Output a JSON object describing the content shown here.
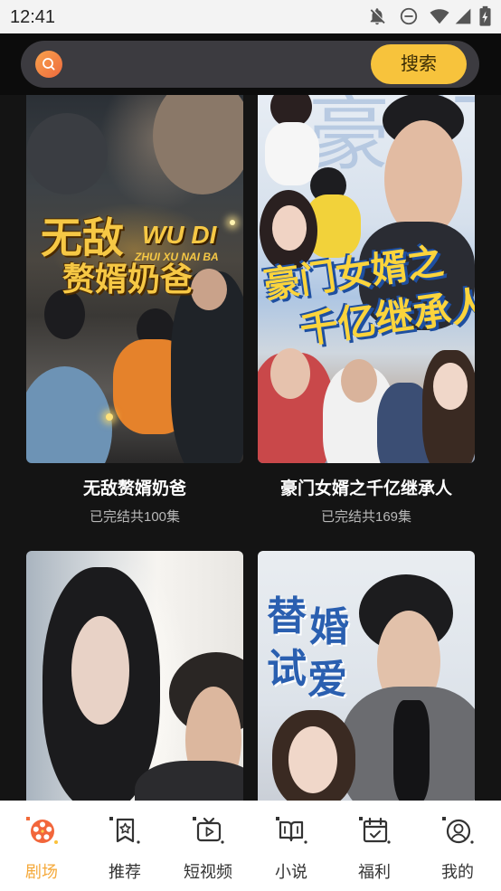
{
  "status_bar": {
    "time": "12:41",
    "icons": [
      "notifications-off-icon",
      "do-not-disturb-icon",
      "wifi-icon",
      "signal-icon",
      "battery-charging-icon"
    ]
  },
  "search": {
    "value": "",
    "icon": "search-icon",
    "button_label": "搜索"
  },
  "dramas": [
    {
      "title": "无敌赘婿奶爸",
      "episodes": "已完结共100集",
      "poster_text": {
        "title_1": "无敌",
        "pinyin_1": "WU DI",
        "pinyin_2": "ZHUI XU NAI BA",
        "title_2": "赘婿奶爸"
      }
    },
    {
      "title": "豪门女婿之千亿继承人",
      "episodes": "已完结共169集",
      "poster_text": {
        "background": "豪门",
        "line_1": "豪门女婿之",
        "line_2": "千亿继承人"
      }
    },
    {
      "poster_text": {}
    },
    {
      "poster_text": {
        "chars": [
          "替",
          "婚",
          "试",
          "爱"
        ]
      }
    }
  ],
  "bottom_nav": {
    "items": [
      {
        "label": "剧场",
        "icon": "theater-icon",
        "active": true
      },
      {
        "label": "推荐",
        "icon": "bookmark-star-icon",
        "active": false
      },
      {
        "label": "短视频",
        "icon": "tv-play-icon",
        "active": false
      },
      {
        "label": "小说",
        "icon": "book-icon",
        "active": false
      },
      {
        "label": "福利",
        "icon": "calendar-check-icon",
        "active": false
      },
      {
        "label": "我的",
        "icon": "profile-icon",
        "active": false
      }
    ]
  },
  "colors": {
    "accent": "#f5a93a",
    "theater_icon": "#f2663b",
    "search_button": "#f7c33c",
    "header_bg": "#0c0c0c",
    "content_bg": "#141414",
    "nav_bg": "#ffffff",
    "nav_inactive": "#333333"
  }
}
